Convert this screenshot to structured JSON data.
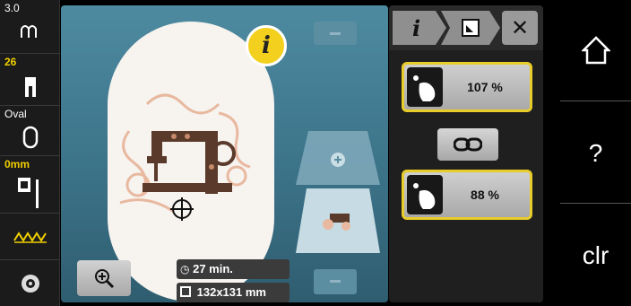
{
  "left_bar": {
    "tension_value": "3.0",
    "presser_foot_value": "26",
    "hoop_label": "Oval",
    "needle_position": "0mm"
  },
  "canvas": {
    "time_text": "27 min.",
    "size_text": "132x131 mm"
  },
  "info_button": {
    "label": "i"
  },
  "right_panel": {
    "tab_info_label": "i",
    "scale_x_value": "107 %",
    "scale_y_value": "88 %"
  },
  "far_right": {
    "help_label": "?",
    "clear_label": "clr"
  },
  "colors": {
    "accent_yellow": "#e8cc2a",
    "canvas_blue": "#3c7389",
    "panel_dark": "#1f1f1f"
  }
}
